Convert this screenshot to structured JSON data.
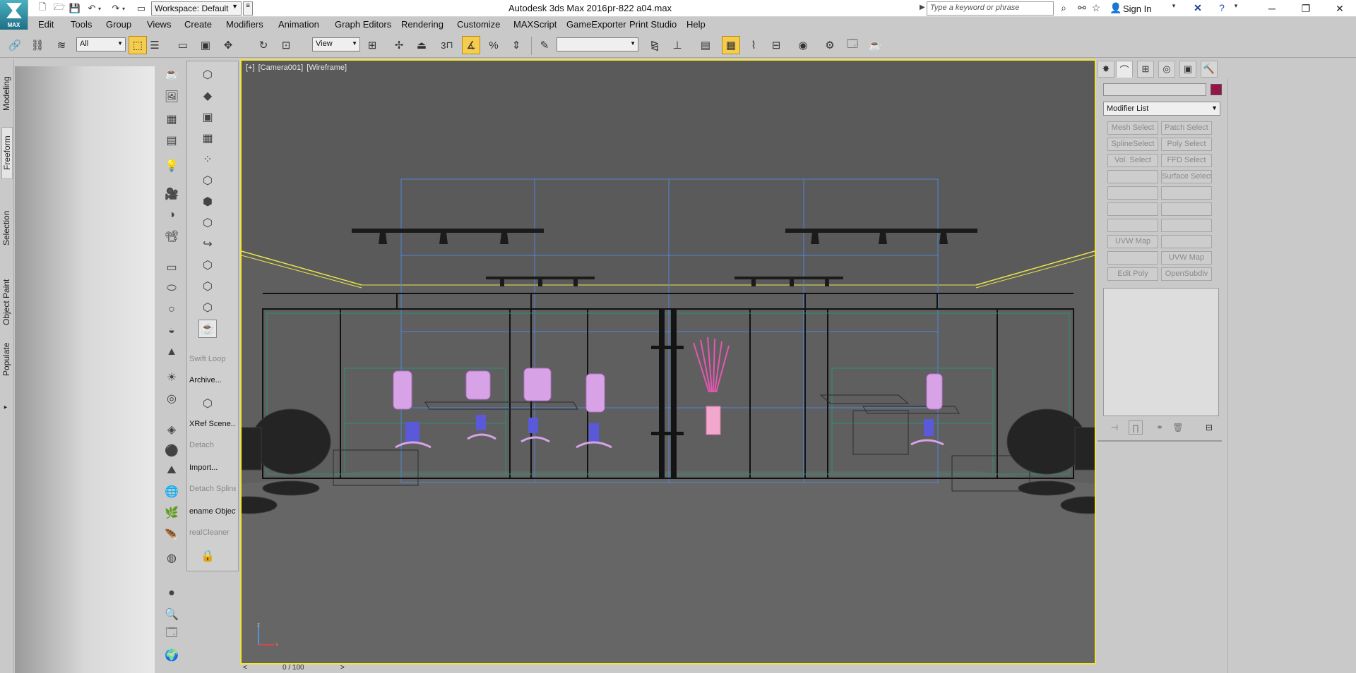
{
  "app": {
    "title": "Autodesk 3ds Max 2016",
    "file": "pr-822 a04.max",
    "logo_caption": "MAX",
    "workspace": "Workspace: Default"
  },
  "search": {
    "placeholder": "Type a keyword or phrase"
  },
  "account": {
    "signin": "Sign In"
  },
  "menu": [
    "Edit",
    "Tools",
    "Group",
    "Views",
    "Create",
    "Modifiers",
    "Animation",
    "Graph Editors",
    "Rendering",
    "Customize",
    "MAXScript",
    "GameExporter",
    "Print Studio",
    "Help"
  ],
  "toolbar": {
    "selection_filter": "All",
    "ref_coord": "View",
    "snap_value": "3",
    "named_selection": ""
  },
  "ribbon": {
    "tabs": [
      "Modeling",
      "Freeform",
      "Selection",
      "Object Paint",
      "Populate"
    ]
  },
  "command_labels": {
    "swift_loop": "Swift Loop",
    "archive": "Archive...",
    "xref_scene": "XRef Scene...",
    "detach": "Detach",
    "import": "Import...",
    "detach_spline": "Detach Spline",
    "rename_objects": "ename Objects",
    "real_cleaner": "realCleaner"
  },
  "viewport": {
    "label_plus": "[+]",
    "label_camera": "[Camera001]",
    "label_shading": "[Wireframe]",
    "active_border_color": "#f2e23a"
  },
  "timeline": {
    "frame": "0 / 100"
  },
  "command_panel": {
    "modifier_list": "Modifier List",
    "object_color": "#99124a",
    "modifier_buttons": [
      "Mesh Select",
      "Patch Select",
      "SplineSelect",
      "Poly Select",
      "Vol. Select",
      "FFD Select",
      "",
      "Surface Select",
      "",
      "",
      "",
      "",
      "",
      "",
      "UVW Map",
      "",
      "",
      "UVW Map",
      "Edit Poly",
      "OpenSubdiv"
    ]
  }
}
